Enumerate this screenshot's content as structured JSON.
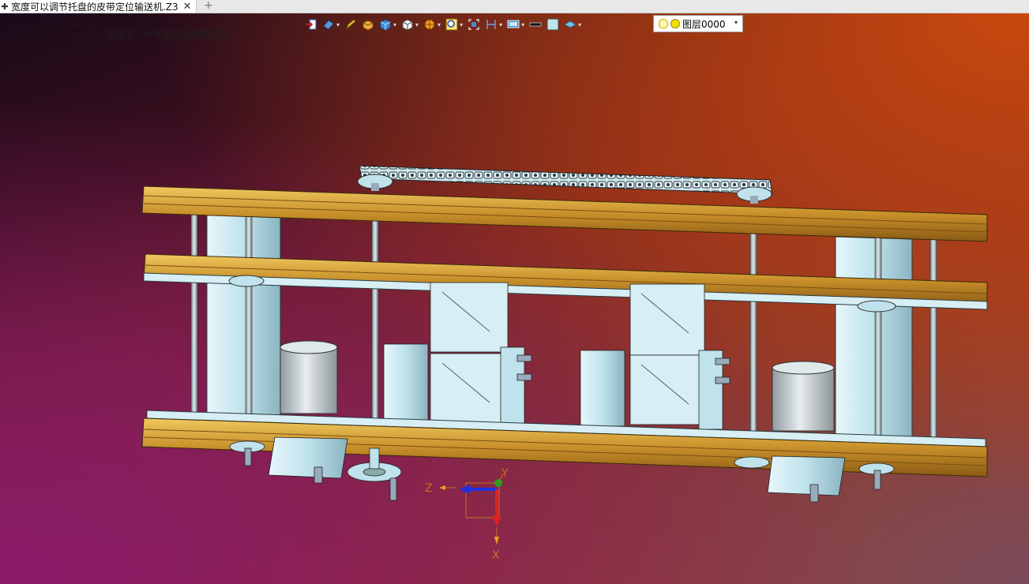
{
  "tab": {
    "title": "宽度可以调节托盘的皮带定位输送机.Z3",
    "pin_icon": "pin-icon",
    "close_glyph": "✕",
    "new_tab_glyph": "+"
  },
  "messages": {
    "line1": "…………………………",
    "line2": "…………………………，直找不一个有效的过滤器设置。"
  },
  "toolbar": {
    "items": [
      "exit-icon",
      "view-icon",
      "pencil-icon",
      "box-shade-icon",
      "cube-blue-icon",
      "cube-white-icon",
      "render-icon",
      "zoom-icon",
      "fit-icon",
      "dimension-icon",
      "display-icon",
      "line-icon",
      "color-box-icon",
      "layer-icon"
    ],
    "layer_value": "图层0000"
  },
  "axes": {
    "x": "X",
    "y": "Y",
    "z": "Z"
  },
  "colors": {
    "bg_top_right": "#c8480e",
    "bg_bottom_left": "#8a1a6a",
    "frame_gold": "#d4a13a",
    "metal": "#bfe4ec",
    "axis_x": "#e02020",
    "axis_y": "#20a020",
    "axis_z": "#2030e0",
    "axis_label": "#c87020"
  }
}
